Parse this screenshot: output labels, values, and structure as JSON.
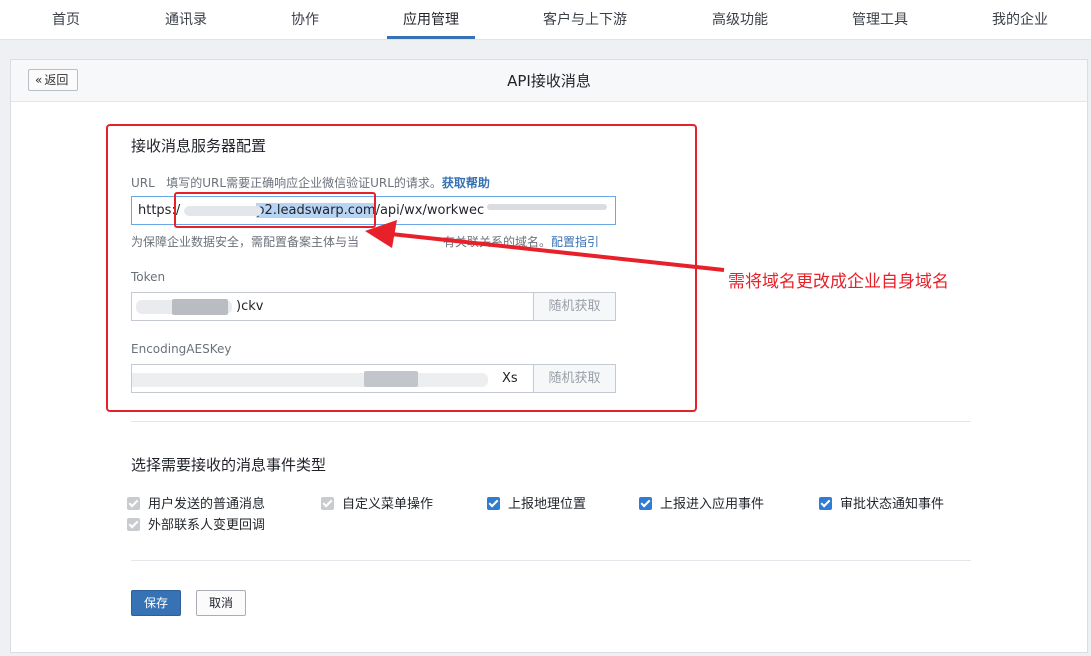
{
  "nav": {
    "items": [
      "首页",
      "通讯录",
      "协作",
      "应用管理",
      "客户与上下游",
      "高级功能",
      "管理工具",
      "我的企业"
    ],
    "active": "应用管理"
  },
  "header": {
    "back_label": "返回",
    "back_icon": "double-chevron-left-icon",
    "title": "API接收消息"
  },
  "server_config": {
    "title": "接收消息服务器配置",
    "url_label": "URL",
    "url_hint": "填写的URL需要正确响应企业微信验证URL的请求。",
    "url_help_link": "获取帮助",
    "url_value_prefix": "https:/",
    "url_value_domain": "p2.leadswarp.com",
    "url_value_path": "/api/wx/workwec",
    "domain_hint": "为保障企业数据安全，需配置备案主体与当",
    "domain_hint_end": "有关联关系的域名。",
    "domain_config_link": "配置指引",
    "token_label": "Token",
    "token_value_visible": ")ckv",
    "aes_label": "EncodingAESKey",
    "aes_value_visible": "Xs",
    "random_button": "随机获取"
  },
  "annotation": {
    "text": "需将域名更改成企业自身域名",
    "color": "#e8202a"
  },
  "events": {
    "title": "选择需要接收的消息事件类型",
    "items": [
      {
        "label": "用户发送的普通消息",
        "checked": true,
        "disabled": true
      },
      {
        "label": "自定义菜单操作",
        "checked": true,
        "disabled": true
      },
      {
        "label": "上报地理位置",
        "checked": true,
        "disabled": false
      },
      {
        "label": "上报进入应用事件",
        "checked": true,
        "disabled": false
      },
      {
        "label": "审批状态通知事件",
        "checked": true,
        "disabled": false
      },
      {
        "label": "外部联系人变更回调",
        "checked": true,
        "disabled": true
      }
    ]
  },
  "actions": {
    "save": "保存",
    "cancel": "取消"
  },
  "colors": {
    "accent": "#3772b5",
    "checkbox_on": "#2f7cd3",
    "checkbox_disabled": "#c9cccf"
  }
}
